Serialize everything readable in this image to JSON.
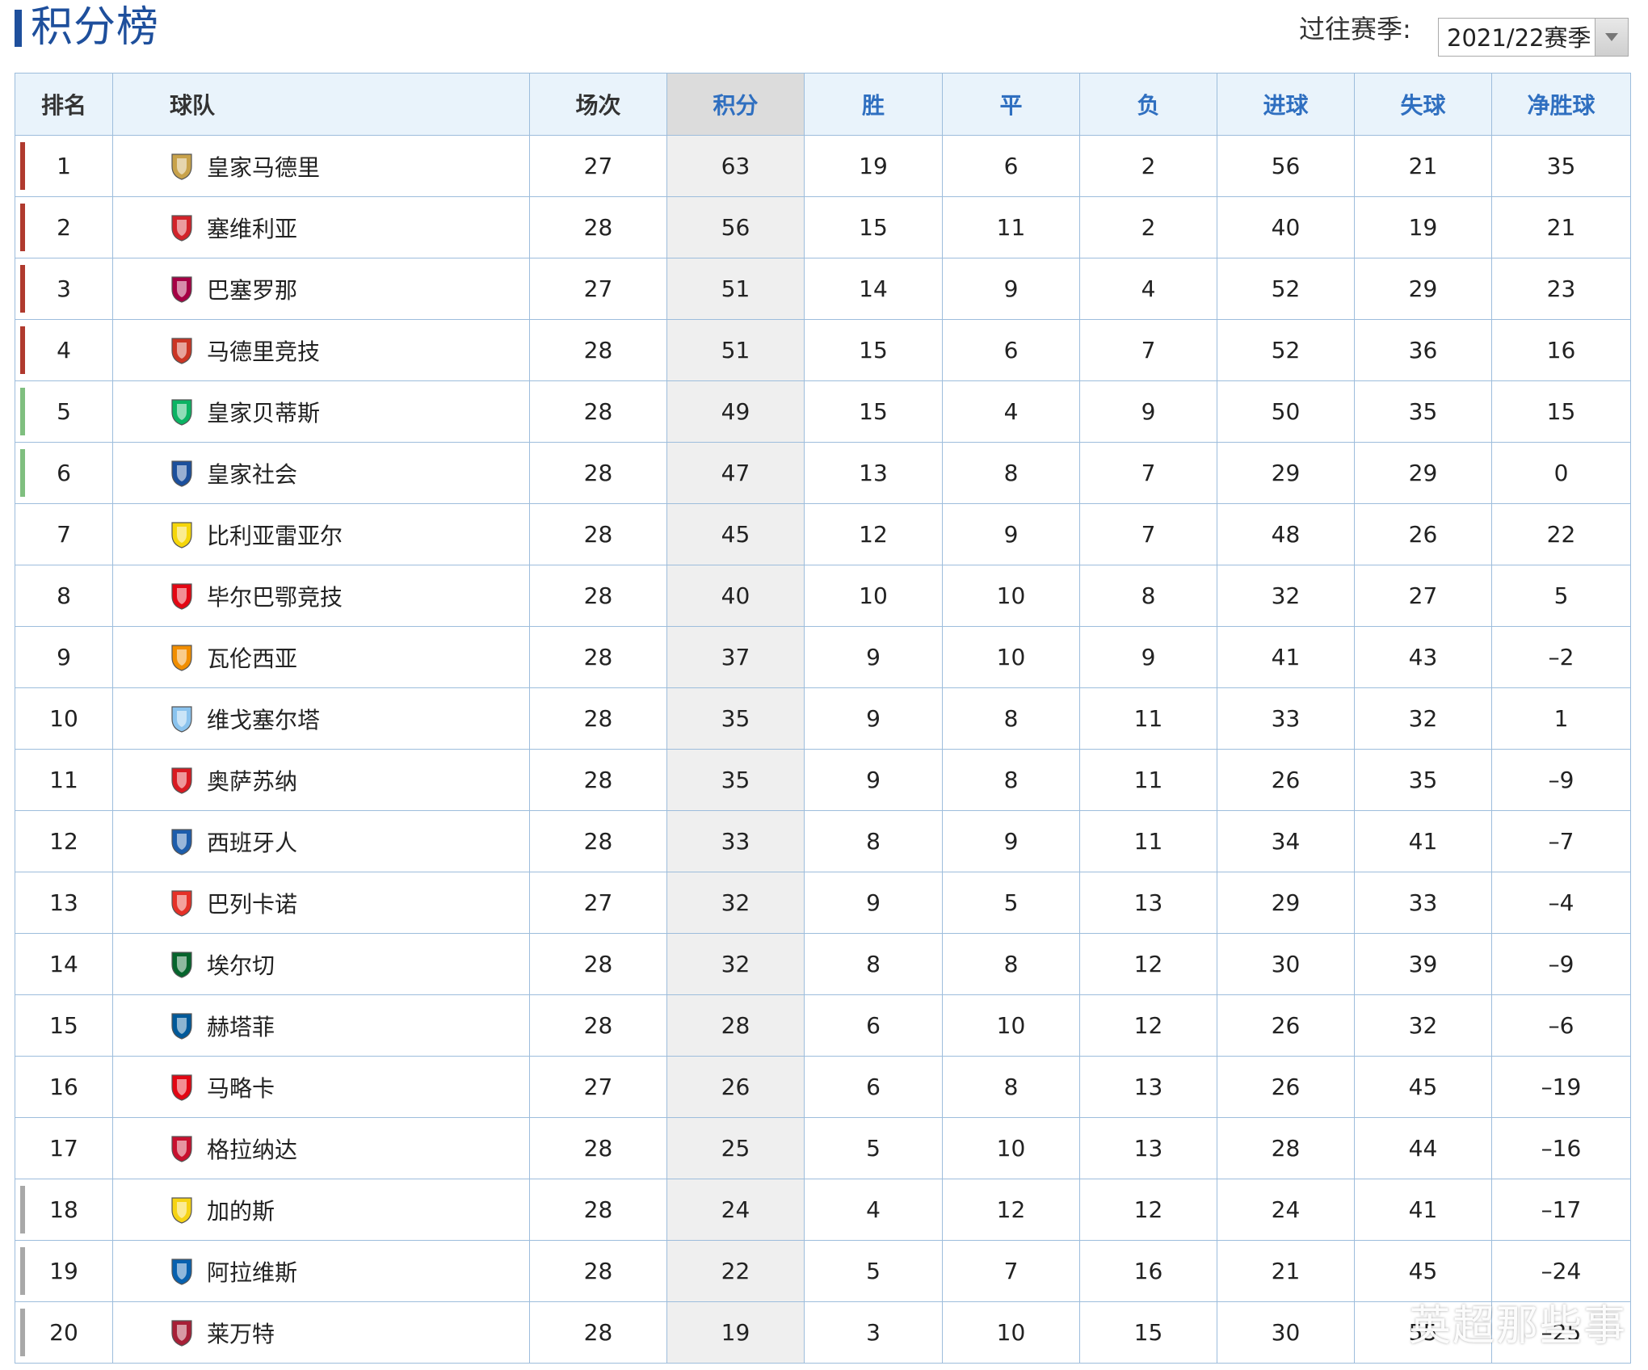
{
  "header": {
    "title": "积分榜",
    "season_label": "过往赛季:",
    "season_value": "2021/22赛季"
  },
  "columns": [
    "排名",
    "球队",
    "场次",
    "积分",
    "胜",
    "平",
    "负",
    "进球",
    "失球",
    "净胜球"
  ],
  "colors": {
    "accent": "#1e4f9c",
    "header_text": "#2f6fc0",
    "border": "#9dbddc",
    "champions": "#b03a2e",
    "europa": "#7fbf7f",
    "relegation": "#a8a8a8"
  },
  "rows": [
    {
      "rank": "1",
      "team": "皇家马德里",
      "played": "27",
      "points": "63",
      "won": "19",
      "drawn": "6",
      "lost": "2",
      "gf": "56",
      "ga": "21",
      "gd": "35",
      "zone": "champions",
      "badge": "real-madrid-badge-icon",
      "badge_color": "#c8a24a"
    },
    {
      "rank": "2",
      "team": "塞维利亚",
      "played": "28",
      "points": "56",
      "won": "15",
      "drawn": "11",
      "lost": "2",
      "gf": "40",
      "ga": "19",
      "gd": "21",
      "zone": "champions",
      "badge": "sevilla-badge-icon",
      "badge_color": "#d2232a"
    },
    {
      "rank": "3",
      "team": "巴塞罗那",
      "played": "27",
      "points": "51",
      "won": "14",
      "drawn": "9",
      "lost": "4",
      "gf": "52",
      "ga": "29",
      "gd": "23",
      "zone": "champions",
      "badge": "barcelona-badge-icon",
      "badge_color": "#a50044"
    },
    {
      "rank": "4",
      "team": "马德里竞技",
      "played": "28",
      "points": "51",
      "won": "15",
      "drawn": "6",
      "lost": "7",
      "gf": "52",
      "ga": "36",
      "gd": "16",
      "zone": "champions",
      "badge": "atletico-badge-icon",
      "badge_color": "#cb3524"
    },
    {
      "rank": "5",
      "team": "皇家贝蒂斯",
      "played": "28",
      "points": "49",
      "won": "15",
      "drawn": "4",
      "lost": "9",
      "gf": "50",
      "ga": "35",
      "gd": "15",
      "zone": "europa",
      "badge": "betis-badge-icon",
      "badge_color": "#0bb363"
    },
    {
      "rank": "6",
      "team": "皇家社会",
      "played": "28",
      "points": "47",
      "won": "13",
      "drawn": "8",
      "lost": "7",
      "gf": "29",
      "ga": "29",
      "gd": "0",
      "zone": "europa",
      "badge": "real-sociedad-badge-icon",
      "badge_color": "#1b4f9c"
    },
    {
      "rank": "7",
      "team": "比利亚雷亚尔",
      "played": "28",
      "points": "45",
      "won": "12",
      "drawn": "9",
      "lost": "7",
      "gf": "48",
      "ga": "26",
      "gd": "22",
      "zone": "",
      "badge": "villarreal-badge-icon",
      "badge_color": "#f5d60a"
    },
    {
      "rank": "8",
      "team": "毕尔巴鄂竞技",
      "played": "28",
      "points": "40",
      "won": "10",
      "drawn": "10",
      "lost": "8",
      "gf": "32",
      "ga": "27",
      "gd": "5",
      "zone": "",
      "badge": "athletic-bilbao-badge-icon",
      "badge_color": "#e30613"
    },
    {
      "rank": "9",
      "team": "瓦伦西亚",
      "played": "28",
      "points": "37",
      "won": "9",
      "drawn": "10",
      "lost": "9",
      "gf": "41",
      "ga": "43",
      "gd": "–2",
      "zone": "",
      "badge": "valencia-badge-icon",
      "badge_color": "#f18e00"
    },
    {
      "rank": "10",
      "team": "维戈塞尔塔",
      "played": "28",
      "points": "35",
      "won": "9",
      "drawn": "8",
      "lost": "11",
      "gf": "33",
      "ga": "32",
      "gd": "1",
      "zone": "",
      "badge": "celta-badge-icon",
      "badge_color": "#8ac3ee"
    },
    {
      "rank": "11",
      "team": "奥萨苏纳",
      "played": "28",
      "points": "35",
      "won": "9",
      "drawn": "8",
      "lost": "11",
      "gf": "26",
      "ga": "35",
      "gd": "–9",
      "zone": "",
      "badge": "osasuna-badge-icon",
      "badge_color": "#d91a21"
    },
    {
      "rank": "12",
      "team": "西班牙人",
      "played": "28",
      "points": "33",
      "won": "8",
      "drawn": "9",
      "lost": "11",
      "gf": "34",
      "ga": "41",
      "gd": "–7",
      "zone": "",
      "badge": "espanyol-badge-icon",
      "badge_color": "#1d5dab"
    },
    {
      "rank": "13",
      "team": "巴列卡诺",
      "played": "27",
      "points": "32",
      "won": "9",
      "drawn": "5",
      "lost": "13",
      "gf": "29",
      "ga": "33",
      "gd": "–4",
      "zone": "",
      "badge": "rayo-badge-icon",
      "badge_color": "#e53027"
    },
    {
      "rank": "14",
      "team": "埃尔切",
      "played": "28",
      "points": "32",
      "won": "8",
      "drawn": "8",
      "lost": "12",
      "gf": "30",
      "ga": "39",
      "gd": "–9",
      "zone": "",
      "badge": "elche-badge-icon",
      "badge_color": "#05642c"
    },
    {
      "rank": "15",
      "team": "赫塔菲",
      "played": "28",
      "points": "28",
      "won": "6",
      "drawn": "10",
      "lost": "12",
      "gf": "26",
      "ga": "32",
      "gd": "–6",
      "zone": "",
      "badge": "getafe-badge-icon",
      "badge_color": "#005999"
    },
    {
      "rank": "16",
      "team": "马略卡",
      "played": "27",
      "points": "26",
      "won": "6",
      "drawn": "8",
      "lost": "13",
      "gf": "26",
      "ga": "45",
      "gd": "–19",
      "zone": "",
      "badge": "mallorca-badge-icon",
      "badge_color": "#e20613"
    },
    {
      "rank": "17",
      "team": "格拉纳达",
      "played": "28",
      "points": "25",
      "won": "5",
      "drawn": "10",
      "lost": "13",
      "gf": "28",
      "ga": "44",
      "gd": "–16",
      "zone": "",
      "badge": "granada-badge-icon",
      "badge_color": "#c8102e"
    },
    {
      "rank": "18",
      "team": "加的斯",
      "played": "28",
      "points": "24",
      "won": "4",
      "drawn": "12",
      "lost": "12",
      "gf": "24",
      "ga": "41",
      "gd": "–17",
      "zone": "relegation",
      "badge": "cadiz-badge-icon",
      "badge_color": "#f6d314"
    },
    {
      "rank": "19",
      "team": "阿拉维斯",
      "played": "28",
      "points": "22",
      "won": "5",
      "drawn": "7",
      "lost": "16",
      "gf": "21",
      "ga": "45",
      "gd": "–24",
      "zone": "relegation",
      "badge": "alaves-badge-icon",
      "badge_color": "#0761af"
    },
    {
      "rank": "20",
      "team": "莱万特",
      "played": "28",
      "points": "19",
      "won": "3",
      "drawn": "10",
      "lost": "15",
      "gf": "30",
      "ga": "55",
      "gd": "–25",
      "zone": "relegation",
      "badge": "levante-badge-icon",
      "badge_color": "#a71f36"
    }
  ],
  "watermark": "英超那些事"
}
